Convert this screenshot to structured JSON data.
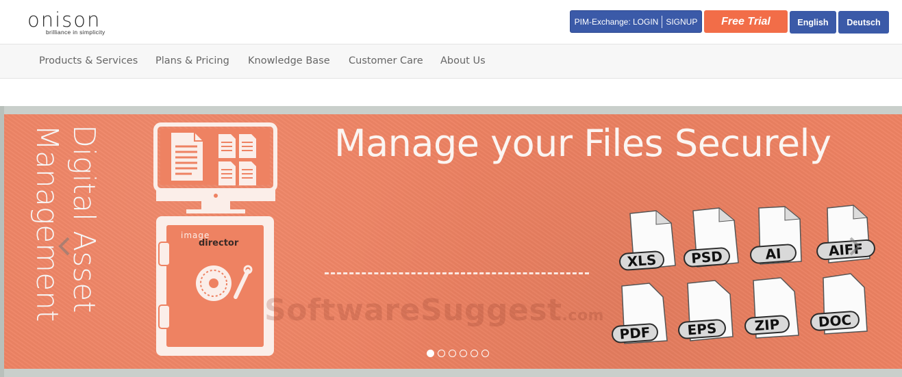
{
  "header": {
    "logo": {
      "word": "onison",
      "tagline": "brilliance in simplicity"
    },
    "pim": {
      "prefix": "PIM-Exchange: LOGIN",
      "signup": "SIGNUP"
    },
    "free_trial": "Free Trial",
    "lang_en": "English",
    "lang_de": "Deutsch"
  },
  "nav": {
    "items": [
      {
        "label": "Products & Services"
      },
      {
        "label": "Plans & Pricing"
      },
      {
        "label": "Knowledge Base"
      },
      {
        "label": "Customer Care"
      },
      {
        "label": "About Us"
      }
    ]
  },
  "banner": {
    "side_line1": "Digital Asset",
    "side_line2": "Management",
    "headline": "Manage your Files Securely",
    "brand_top": "image",
    "brand_bottom": "director",
    "file_types": [
      "XLS",
      "PSD",
      "AI",
      "AIFF",
      "PDF",
      "EPS",
      "ZIP",
      "DOC"
    ],
    "watermark": "SoftwareSuggest",
    "watermark_suffix": ".com",
    "slides": 6,
    "active_slide": 1
  },
  "colors": {
    "brand_blue": "#3b5aa8",
    "trial_orange": "#f26d48",
    "banner_orange": "#ee8262",
    "nav_bg": "#f7f7f7"
  }
}
